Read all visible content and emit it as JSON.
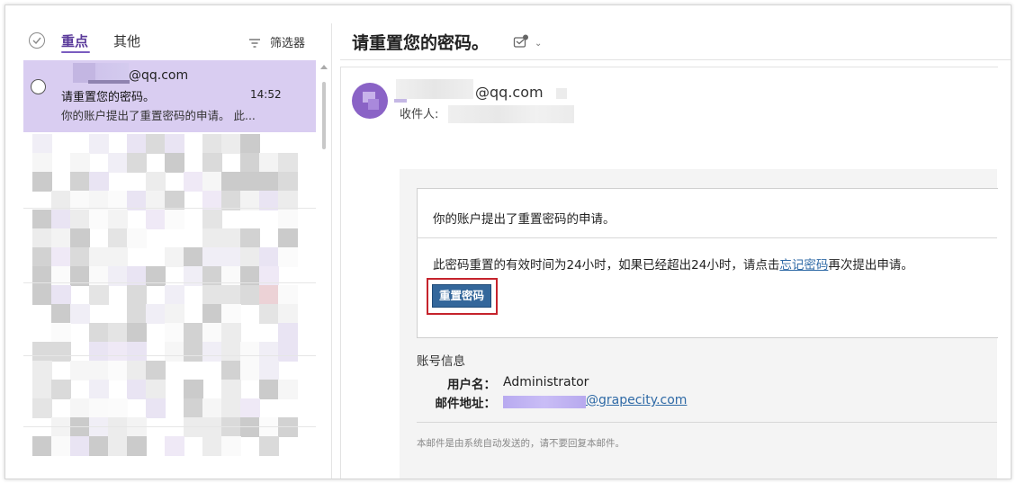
{
  "mail_list": {
    "tabs": [
      "重点",
      "其他"
    ],
    "filter_label": "筛选器",
    "selected_message": {
      "sender": "@qq.com",
      "subject": "请重置您的密码。",
      "time": "14:52",
      "preview": "你的账户提出了重置密码的申请。 此..."
    }
  },
  "reading_pane": {
    "subject": "请重置您的密码。",
    "from": "@qq.com",
    "to_label": "收件人:",
    "body": {
      "line1": "你的账户提出了重置密码的申请。",
      "line2_before": "此密码重置的有效时间为24小时，如果已经超出24小时，请点击",
      "line2_link": "忘记密码",
      "line2_after": "再次提出申请。",
      "reset_button": "重置密码",
      "account_title": "账号信息",
      "username_label": "用户名：",
      "username_value": "Administrator",
      "email_label": "邮件地址：",
      "email_value": "@grapecity.com",
      "footer": "本邮件是由系统自动发送的，请不要回复本邮件。"
    }
  },
  "colors": {
    "selected_row": "#d9cdf1",
    "accent": "#7a5cc0",
    "button": "#34679b",
    "highlight_box": "#c5232c",
    "link": "#2f6aa6"
  }
}
